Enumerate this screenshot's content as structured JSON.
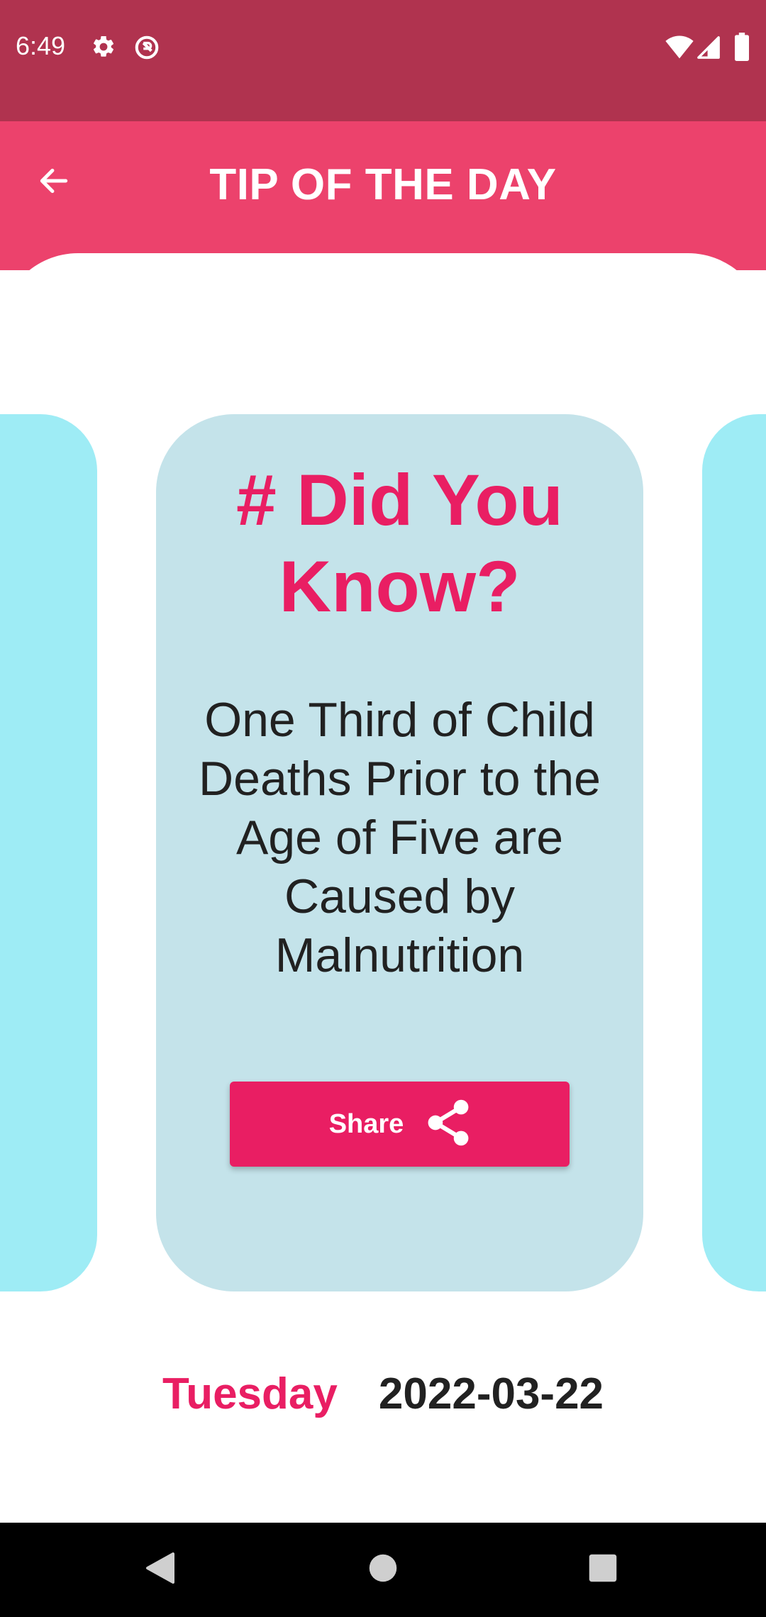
{
  "status_bar": {
    "time": "6:49",
    "icons": [
      "gear-icon",
      "do-not-disturb-icon",
      "wifi-icon",
      "signal-icon",
      "battery-icon"
    ]
  },
  "app_bar": {
    "title": "TIP OF THE DAY",
    "back_icon": "arrow-left-icon"
  },
  "tip_card": {
    "heading": "# Did You Know?",
    "body": "One Third of Child Deaths Prior to the Age of Five are Caused by Malnutrition",
    "share_label": "Share",
    "share_icon": "share-icon"
  },
  "date": {
    "day": "Tuesday",
    "date": "2022-03-22"
  },
  "nav_bar": {
    "buttons": [
      "back-triangle-icon",
      "home-circle-icon",
      "recents-square-icon"
    ]
  },
  "colors": {
    "status_bar": "#b0334f",
    "app_bar": "#ec426c",
    "accent": "#e91e63",
    "card": "#c4e3ea",
    "card_peek": "#9eecf5",
    "text_dark": "#212121"
  }
}
